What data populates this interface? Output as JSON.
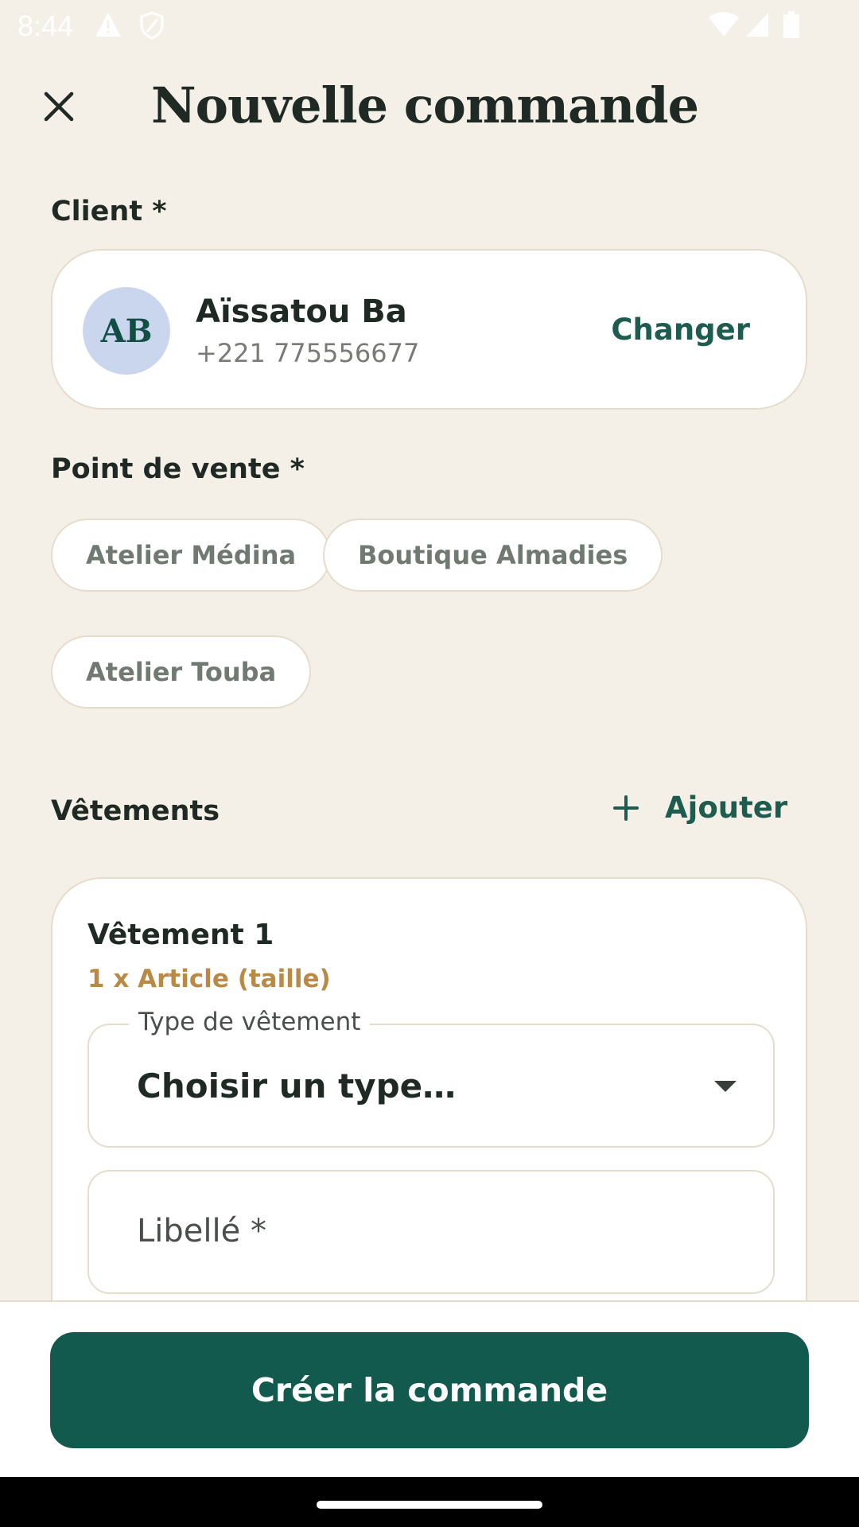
{
  "status_bar": {
    "time": "8:44",
    "icons": [
      "warning-icon",
      "shield-icon",
      "wifi-icon",
      "signal-icon",
      "battery-icon"
    ]
  },
  "header": {
    "title": "Nouvelle commande",
    "close_icon": "close-icon"
  },
  "client": {
    "label": "Client *",
    "initials": "AB",
    "name": "Aïssatou Ba",
    "phone": "+221 775556677",
    "change_label": "Changer"
  },
  "point_de_vente": {
    "label": "Point de vente *",
    "options": [
      "Atelier Médina",
      "Boutique Almadies",
      "Atelier Touba"
    ]
  },
  "vetements": {
    "label": "Vêtements",
    "add_label": "Ajouter",
    "items": [
      {
        "title": "Vêtement 1",
        "subtitle": "1 x Article (taille)",
        "type_legend": "Type de vêtement",
        "type_value": "Choisir un type…",
        "libelle_placeholder": "Libellé *"
      }
    ]
  },
  "footer": {
    "submit_label": "Créer la commande"
  },
  "colors": {
    "background": "#F4F0E8",
    "primary": "#125A4D",
    "accent": "#B98A46",
    "avatar": "#C9D6EE"
  }
}
